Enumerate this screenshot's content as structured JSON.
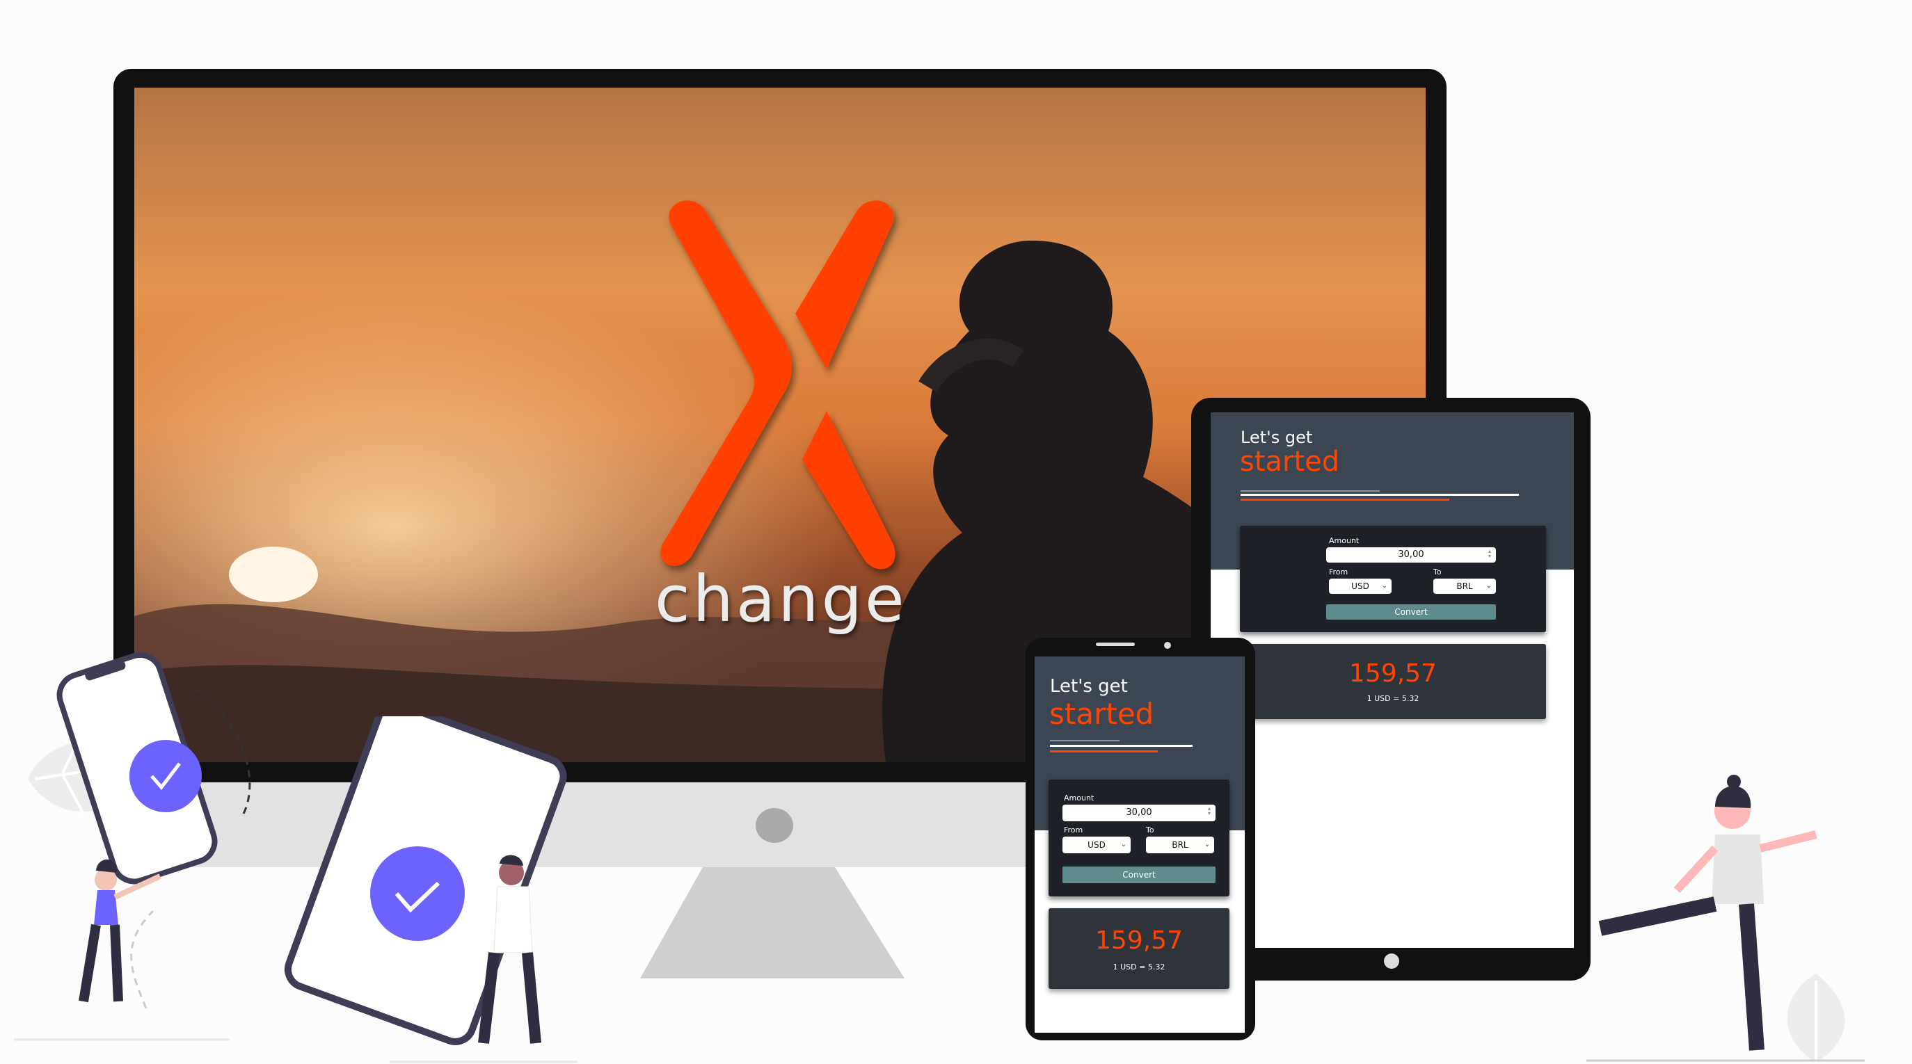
{
  "brand": {
    "logo_letter": "X",
    "logo_word": "change",
    "accent_color": "#ff4500",
    "dark_color": "#3b4652"
  },
  "app": {
    "greeting_line1": "Let's get",
    "greeting_line2": "started",
    "amount_label": "Amount",
    "amount_value": "30,00",
    "from_label": "From",
    "to_label": "To",
    "from_currency": "USD",
    "to_currency": "BRL",
    "convert_label": "Convert",
    "result_value": "159,57",
    "rate_text": "1 USD = 5.32"
  },
  "illustration": {
    "check_icons": [
      "check-circle-icon",
      "check-circle-icon"
    ],
    "check_color": "#6c63ff"
  }
}
